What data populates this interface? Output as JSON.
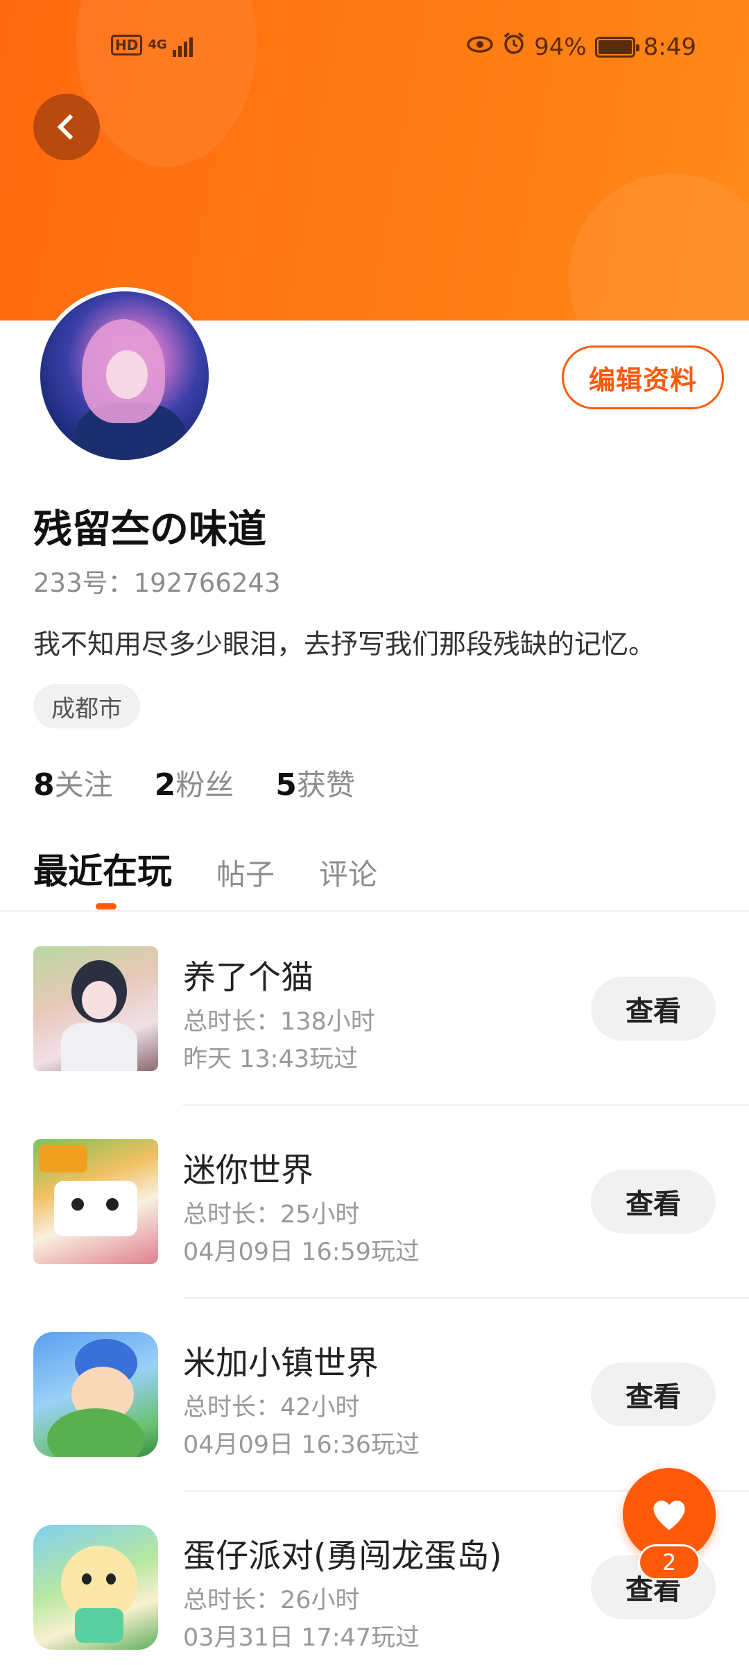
{
  "status_bar": {
    "hd": "HD",
    "network": "4G",
    "battery": "94%",
    "time": "8:49"
  },
  "profile": {
    "edit_label": "编辑资料",
    "name": "残留夳の味道",
    "uid": "233号：192766243",
    "bio": "我不知用尽多少眼泪，去抒写我们那段残缺的记忆。",
    "location": "成都市",
    "stats": [
      {
        "num": "8",
        "label": "关注"
      },
      {
        "num": "2",
        "label": "粉丝"
      },
      {
        "num": "5",
        "label": "获赞"
      }
    ]
  },
  "tabs": [
    "最近在玩",
    "帖子",
    "评论"
  ],
  "games": [
    {
      "title": "养了个猫",
      "duration": "总时长：138小时",
      "last_played": "昨天 13:43玩过",
      "action": "查看"
    },
    {
      "title": "迷你世界",
      "duration": "总时长：25小时",
      "last_played": "04月09日 16:59玩过",
      "action": "查看"
    },
    {
      "title": "米加小镇世界",
      "duration": "总时长：42小时",
      "last_played": "04月09日 16:36玩过",
      "action": "查看"
    },
    {
      "title": "蛋仔派对(勇闯龙蛋岛)",
      "duration": "总时长：26小时",
      "last_played": "03月31日 17:47玩过",
      "action": "查看"
    }
  ],
  "like_fab": {
    "count": "2"
  },
  "colors": {
    "accent": "#ff5a0a",
    "header": "#ff7a12"
  }
}
